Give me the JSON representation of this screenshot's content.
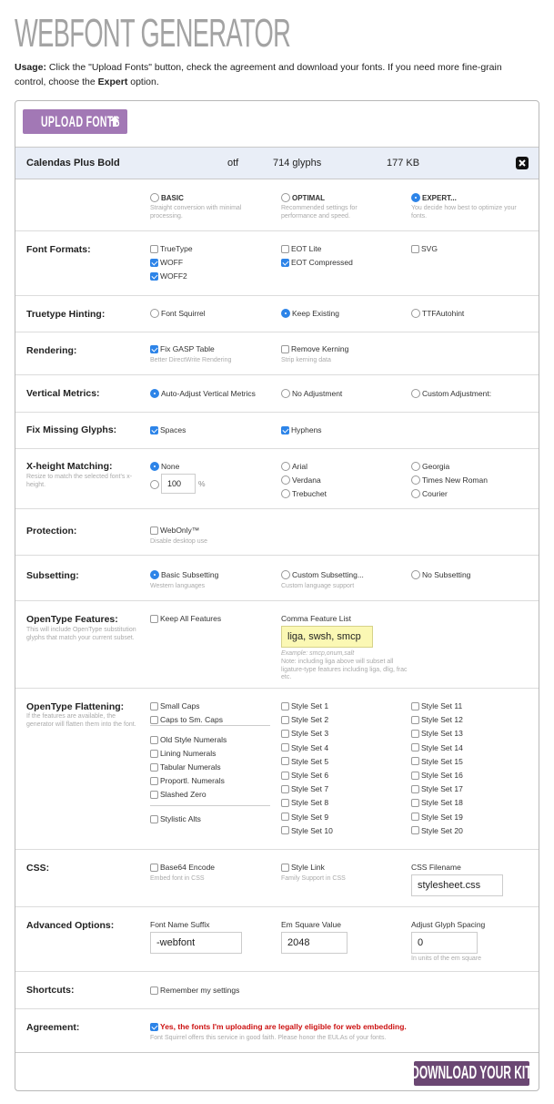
{
  "page": {
    "title": "WEBFONT GENERATOR",
    "usage_label": "Usage:",
    "usage_text_1": " Click the \"Upload Fonts\" button, check the agreement and download your fonts. If you need more fine-grain control, choose the ",
    "usage_expert": "Expert",
    "usage_text_2": " option."
  },
  "upload_button": {
    "label": "UPLOAD FONTS",
    "icon": "arrow-up-icon"
  },
  "file": {
    "name": "Calendas Plus Bold",
    "format": "otf",
    "glyphs": "714 glyphs",
    "size": "177 KB",
    "remove_icon": "close-icon"
  },
  "modes": [
    {
      "label": "BASIC",
      "desc_1": "Straight conversion with minimal",
      "desc_2": "processing.",
      "selected": false
    },
    {
      "label": "OPTIMAL",
      "desc_1": "Recommended settings for",
      "desc_2": "performance and speed.",
      "selected": false
    },
    {
      "label": "EXPERT...",
      "desc_1": "You decide how best to optimize your",
      "desc_2": "fonts.",
      "selected": true
    }
  ],
  "font_formats": {
    "label": "Font Formats:",
    "options": [
      {
        "label": "TrueType",
        "checked": false
      },
      {
        "label": "WOFF",
        "checked": true
      },
      {
        "label": "WOFF2",
        "checked": true
      },
      {
        "label": "EOT Lite",
        "checked": false
      },
      {
        "label": "EOT Compressed",
        "checked": true
      },
      {
        "label": "SVG",
        "checked": false
      }
    ]
  },
  "hinting": {
    "label": "Truetype Hinting:",
    "options": [
      {
        "label": "Font Squirrel",
        "selected": false
      },
      {
        "label": "Keep Existing",
        "selected": true
      },
      {
        "label": "TTFAutohint",
        "selected": false
      }
    ]
  },
  "rendering": {
    "label": "Rendering:",
    "options": [
      {
        "label": "Fix GASP Table",
        "desc": "Better DirectWrite Rendering",
        "checked": true
      },
      {
        "label": "Remove Kerning",
        "desc": "Strip kerning data",
        "checked": false
      }
    ]
  },
  "vertical_metrics": {
    "label": "Vertical Metrics:",
    "options": [
      {
        "label": "Auto-Adjust Vertical Metrics",
        "selected": true
      },
      {
        "label": "No Adjustment",
        "selected": false
      },
      {
        "label": "Custom Adjustment:",
        "selected": false
      }
    ]
  },
  "missing_glyphs": {
    "label": "Fix Missing Glyphs:",
    "options": [
      {
        "label": "Spaces",
        "checked": true
      },
      {
        "label": "Hyphens",
        "checked": true
      }
    ]
  },
  "xheight": {
    "label": "X-height Matching:",
    "desc": "Resize to match the selected font's x-height.",
    "options": [
      {
        "label": "None",
        "selected": true
      },
      {
        "label": "Arial",
        "selected": false
      },
      {
        "label": "Verdana",
        "selected": false
      },
      {
        "label": "Trebuchet",
        "selected": false
      },
      {
        "label": "Georgia",
        "selected": false
      },
      {
        "label": "Times New Roman",
        "selected": false
      },
      {
        "label": "Courier",
        "selected": false
      }
    ],
    "percent_value": "100",
    "percent_unit": "%"
  },
  "protection": {
    "label": "Protection:",
    "option": {
      "label": "WebOnly™",
      "desc": "Disable desktop use",
      "checked": false
    }
  },
  "subsetting": {
    "label": "Subsetting:",
    "options": [
      {
        "label": "Basic Subsetting",
        "desc": "Western languages",
        "selected": true
      },
      {
        "label": "Custom Subsetting...",
        "desc": "Custom language support",
        "selected": false
      },
      {
        "label": "No Subsetting",
        "desc": "",
        "selected": false
      }
    ]
  },
  "opentype_features": {
    "label": "OpenType Features:",
    "desc": "This will include OpenType substitution glyphs that match your current subset.",
    "keep_all": {
      "label": "Keep All Features",
      "checked": false
    },
    "list_label": "Comma Feature List",
    "list_value": "liga, swsh, smcp",
    "example": "Example: smcp,onum,salt",
    "note": "Note: including liga above will subset all ligature-type features including liga, dlig, frac etc."
  },
  "flattening": {
    "label": "OpenType Flattening:",
    "desc": "If the features are available, the generator will flatten them into the font.",
    "group1": [
      "Small Caps",
      "Caps to Sm. Caps"
    ],
    "group2": [
      "Old Style Numerals",
      "Lining Numerals",
      "Tabular Numerals",
      "Proportl. Numerals",
      "Slashed Zero"
    ],
    "group3": [
      "Stylistic Alts"
    ],
    "style_sets_a": [
      "Style Set 1",
      "Style Set 2",
      "Style Set 3",
      "Style Set 4",
      "Style Set 5",
      "Style Set 6",
      "Style Set 7",
      "Style Set 8",
      "Style Set 9",
      "Style Set 10"
    ],
    "style_sets_b": [
      "Style Set 11",
      "Style Set 12",
      "Style Set 13",
      "Style Set 14",
      "Style Set 15",
      "Style Set 16",
      "Style Set 17",
      "Style Set 18",
      "Style Set 19",
      "Style Set 20"
    ]
  },
  "css": {
    "label": "CSS:",
    "base64": {
      "label": "Base64 Encode",
      "desc": "Embed font in CSS",
      "checked": false
    },
    "style_link": {
      "label": "Style Link",
      "desc": "Family Support in CSS",
      "checked": false
    },
    "filename_label": "CSS Filename",
    "filename_value": "stylesheet.css"
  },
  "advanced": {
    "label": "Advanced Options:",
    "suffix_label": "Font Name Suffix",
    "suffix_value": "-webfont",
    "em_label": "Em Square Value",
    "em_value": "2048",
    "spacing_label": "Adjust Glyph Spacing",
    "spacing_value": "0",
    "spacing_desc": "In units of the em square"
  },
  "shortcuts": {
    "label": "Shortcuts:",
    "option": {
      "label": "Remember my settings",
      "checked": false
    }
  },
  "agreement": {
    "label": "Agreement:",
    "text": "Yes, the fonts I'm uploading are legally eligible for web embedding.",
    "desc": "Font Squirrel offers this service in good faith. Please honor the EULAs of your fonts.",
    "checked": true
  },
  "download_button": {
    "label": "DOWNLOAD YOUR KIT"
  },
  "colors": {
    "upload_button": "#a278b5",
    "download_button": "#6b4773",
    "file_row_bg": "#e9eef7",
    "checked_blue": "#2d84e8",
    "agreement_red": "#cc1111",
    "feature_input_bg": "#fbf8b4"
  }
}
